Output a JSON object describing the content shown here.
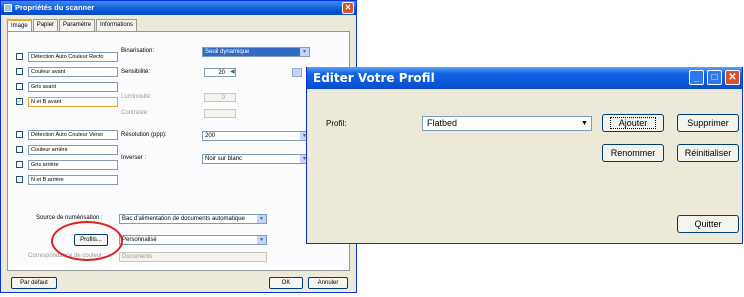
{
  "scanner_window": {
    "title": "Propriétés du scanner",
    "tabs": [
      "Image",
      "Papier",
      "Paramètre",
      "Informations"
    ],
    "image_types": [
      {
        "label": "Détection Auto Couleur Recto",
        "checked": false
      },
      {
        "label": "Couleur avant",
        "checked": false
      },
      {
        "label": "Gris avant",
        "checked": false
      },
      {
        "label": "N et B avant",
        "checked": true
      },
      {
        "label": "Détection Auto Couleur Verso",
        "checked": false
      },
      {
        "label": "Couleur arrière",
        "checked": false
      },
      {
        "label": "Gris arrière",
        "checked": false
      },
      {
        "label": "N et B arrière",
        "checked": false
      }
    ],
    "settings": {
      "binarisation_label": "Binarisation:",
      "binarisation_value": "Seuil dynamique",
      "sensibilite_label": "Sensibilité:",
      "sensibilite_value": "20",
      "luminosite_label": "Luminosité:",
      "luminosite_value": "0",
      "contraste_label": "Contraste:",
      "resolution_label": "Résolution (ppp):",
      "resolution_value": "200",
      "inverser_label": "Inverser :",
      "inverser_value": "Noir sur blanc"
    },
    "source_label": "Source de numérisation :",
    "source_value": "Bac d'alimentation de documents automatique",
    "profil_button": "Profils...",
    "profil_value": "Personnalisé",
    "correspondance_label": "Correspondance de couleur :",
    "correspondance_value": "Documents",
    "defaults_button": "Par défaut",
    "ok_button": "OK",
    "cancel_button": "Annuler"
  },
  "profile_dialog": {
    "title": "Editer Votre Profil",
    "profil_label": "Profil:",
    "profil_value": "Flatbed",
    "buttons": {
      "ajouter": "Ajouter",
      "supprimer": "Supprimer",
      "renommer": "Renommer",
      "reinitialiser": "Réinitialiser",
      "quitter": "Quitter"
    },
    "window_buttons": {
      "minimize": "_",
      "maximize": "□",
      "close": "✕"
    }
  },
  "colors": {
    "xp_title_blue": "#0a58da",
    "window_face": "#ece9d8",
    "highlight": "#316ac5",
    "annotation_red": "#e02020"
  }
}
